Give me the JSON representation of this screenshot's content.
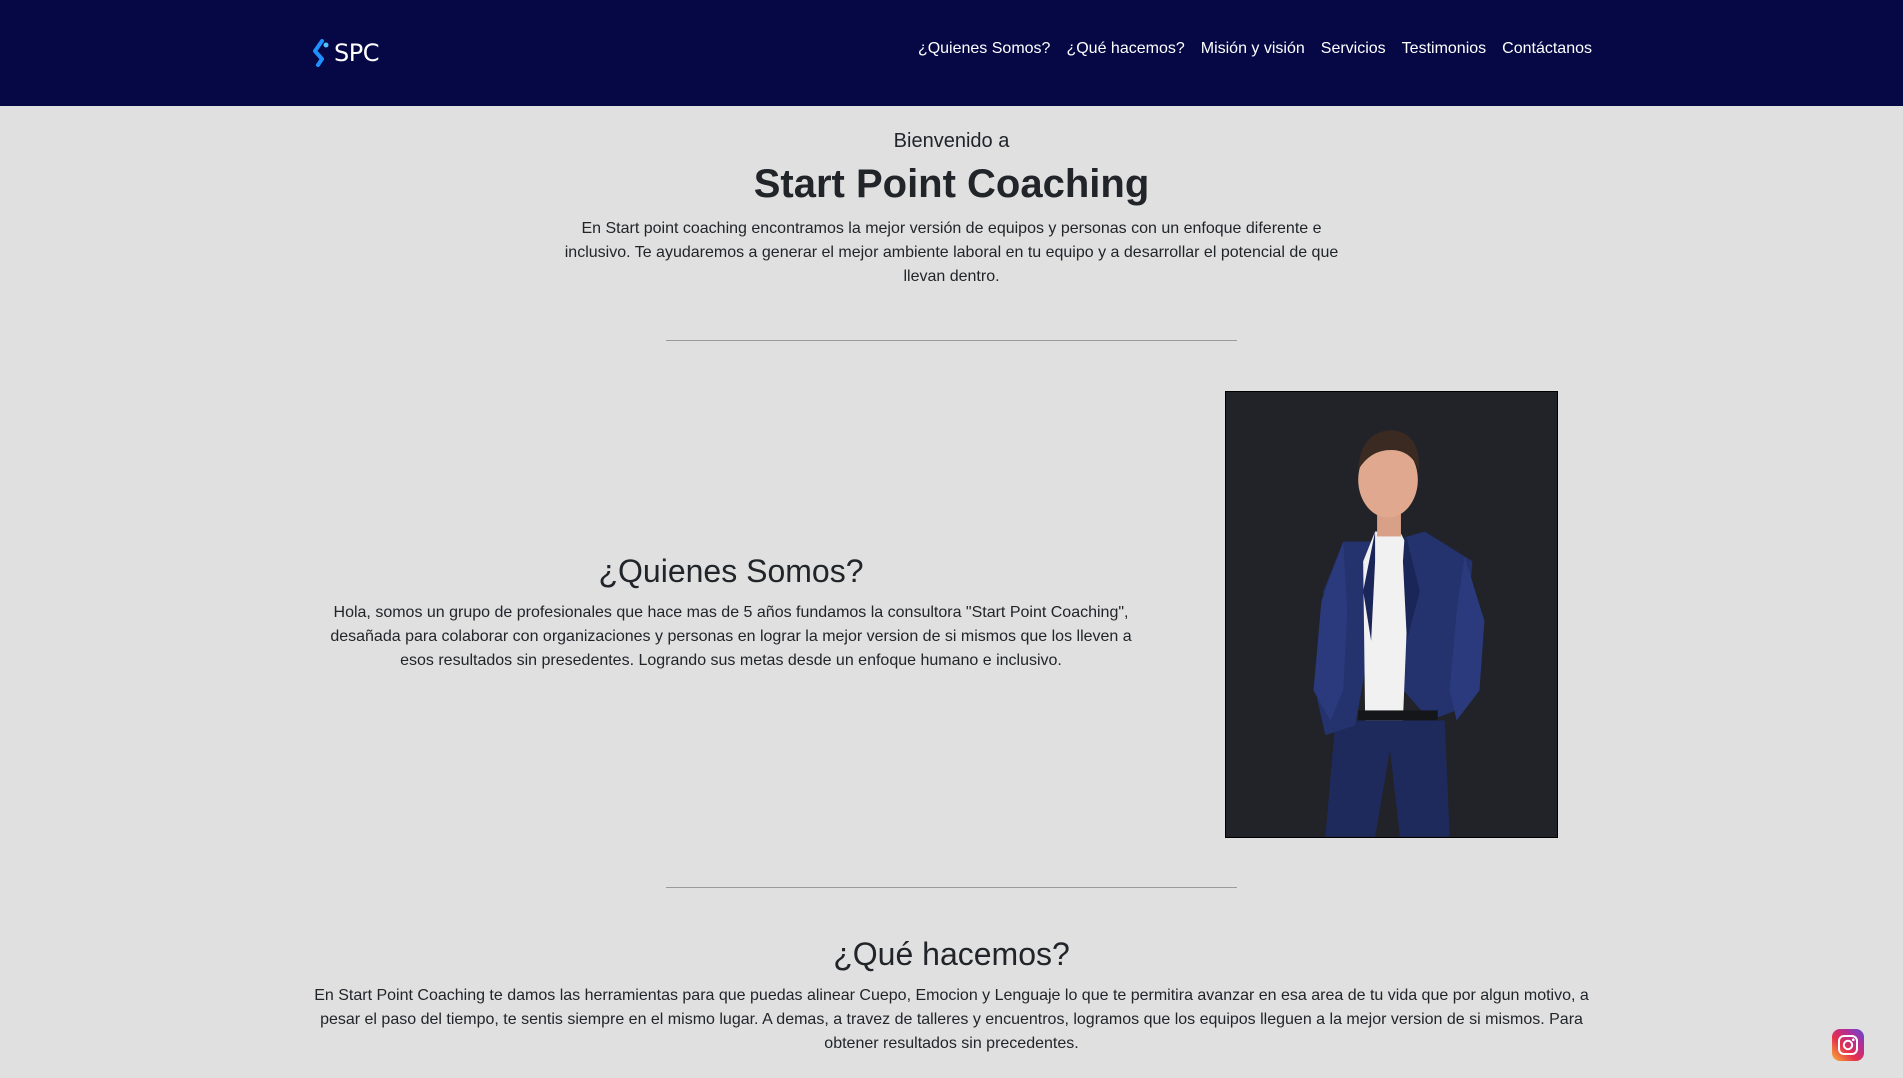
{
  "nav": {
    "brand": "SPC",
    "links": [
      "¿Quienes Somos?",
      "¿Qué hacemos?",
      "Misión y visión",
      "Servicios",
      "Testimonios",
      "Contáctanos"
    ]
  },
  "welcome": {
    "kicker": "Bienvenido a",
    "title": "Start Point Coaching",
    "text": "En Start point coaching encontramos la mejor versión de equipos y personas con un enfoque diferente e inclusivo. Te ayudaremos a generar el mejor ambiente laboral en tu equipo y a desarrollar el potencial de que llevan dentro."
  },
  "about": {
    "heading": "¿Quienes Somos?",
    "text": "Hola, somos un grupo de profesionales que hace mas de 5 años fundamos la consultora \"Start Point Coaching\", desañada para colaborar con organizaciones y personas en lograr la mejor version de si mismos que los lleven a esos resultados sin presedentes. Logrando sus metas desde un enfoque humano e inclusivo."
  },
  "what": {
    "heading": "¿Qué hacemos?",
    "text": "En Start Point Coaching te damos las herramientas para que puedas alinear Cuepo, Emocion y Lenguaje lo que te permitira avanzar en esa area de tu vida que por algun motivo, a pesar el paso del tiempo, te sentis siempre en el mismo lugar. A demas, a travez de talleres y encuentros, logramos que los equipos lleguen a la mejor version de si mismos. Para obtener resultados sin precedentes."
  },
  "icons": {
    "brand_logo": "spc-logo-icon",
    "social": "instagram-icon"
  },
  "colors": {
    "navbar": "#050845",
    "page_background": "#e0e0e0",
    "photo_background": "#212328",
    "brand_accent": "#1e90ff"
  }
}
